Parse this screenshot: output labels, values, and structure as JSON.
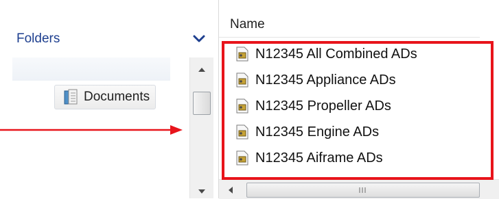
{
  "navigation_pane": {
    "header": {
      "label": "Folders",
      "chevron_icon": "chevron-down-icon"
    },
    "tree_items": [
      {
        "label": "Documents",
        "icon": "documents-library-icon"
      }
    ]
  },
  "file_list": {
    "column_header": "Name",
    "files": [
      {
        "name": "N12345 All Combined ADs",
        "icon": "document-file-icon"
      },
      {
        "name": "N12345 Appliance ADs",
        "icon": "document-file-icon"
      },
      {
        "name": "N12345 Propeller ADs",
        "icon": "document-file-icon"
      },
      {
        "name": "N12345 Engine ADs",
        "icon": "document-file-icon"
      },
      {
        "name": "N12345 Aiframe ADs",
        "icon": "document-file-icon"
      }
    ]
  },
  "annotation": {
    "highlight_color": "#e8141b",
    "arrow_color": "#e8141b"
  },
  "colors": {
    "folders_header_text": "#1e3f8f",
    "chevron": "#1e3f8f"
  }
}
